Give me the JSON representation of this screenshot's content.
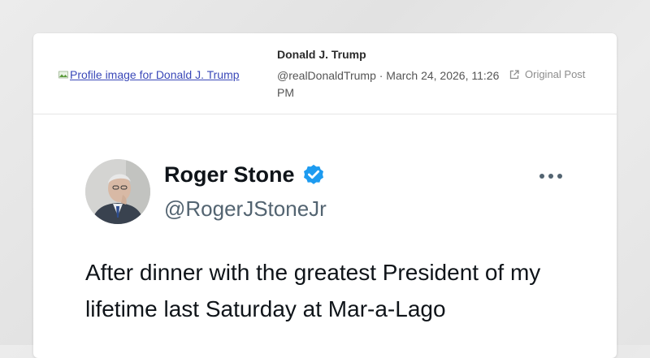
{
  "header": {
    "profile_image_alt": "Profile image for Donald J. Trump",
    "author_name": "Donald J. Trump",
    "author_meta": "@realDonaldTrump · March 24, 2026, 11:26 PM",
    "original_post_label": "Original Post"
  },
  "post": {
    "name": "Roger Stone",
    "handle": "@RogerJStoneJr",
    "text": "After dinner with the greatest President of my lifetime last Saturday at Mar-a-Lago"
  },
  "colors": {
    "verified_badge": "#1d9bf0",
    "link": "#3a48b8",
    "handle": "#536471"
  }
}
